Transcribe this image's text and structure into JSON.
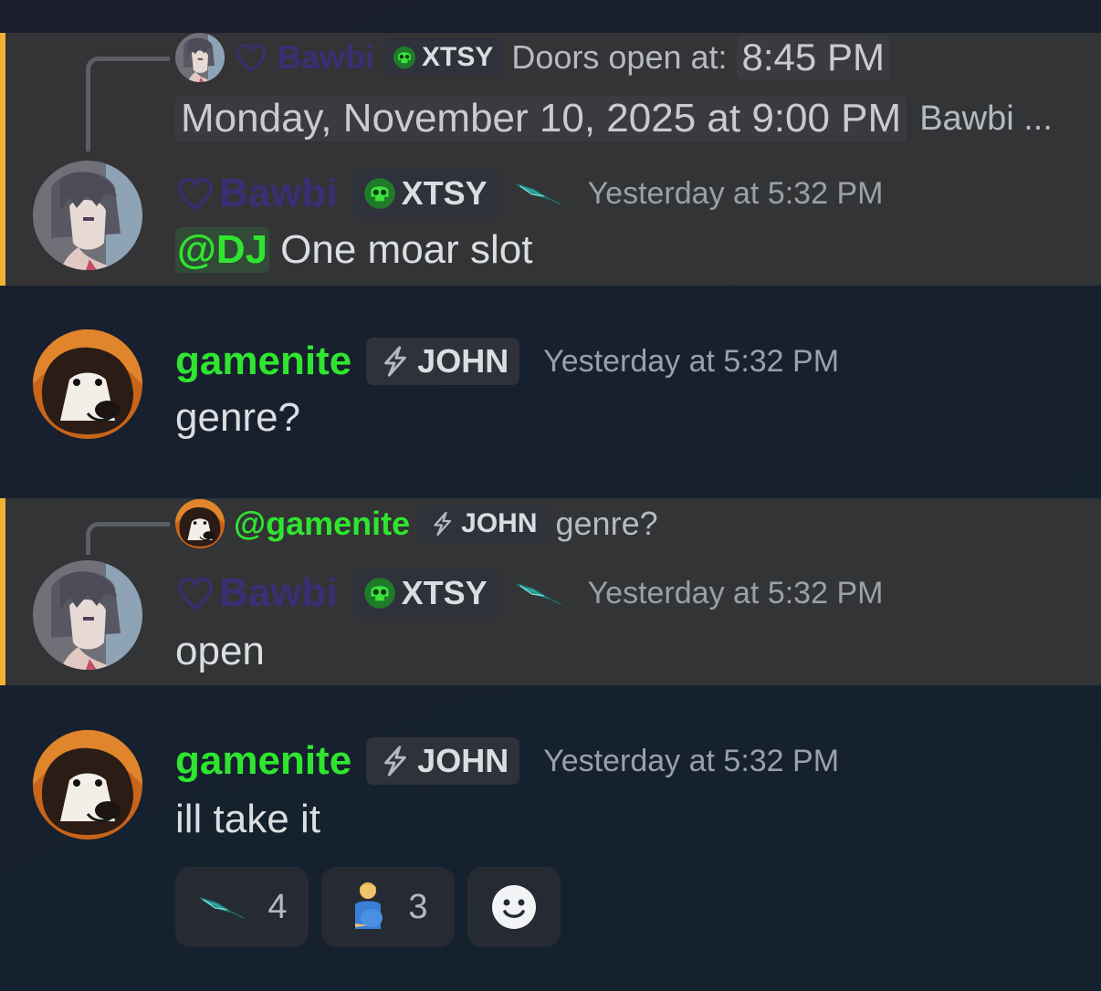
{
  "messages": [
    {
      "reply": {
        "author": "Bawbi",
        "role_tag": "XTSY",
        "text": "Doors open at:",
        "timestamp_chip": "8:45 PM",
        "timestamp_full": "Monday, November 10, 2025 at 9:00 PM",
        "trailing": "Bawbi ..."
      },
      "author": "Bawbi",
      "role_tag": "XTSY",
      "timestamp": "Yesterday at 5:32 PM",
      "mention": "@DJ",
      "content": "One moar slot"
    },
    {
      "author": "gamenite",
      "role_tag": "JOHN",
      "timestamp": "Yesterday at 5:32 PM",
      "content": "genre?"
    },
    {
      "reply": {
        "author": "@gamenite",
        "role_tag": "JOHN",
        "text": "genre?"
      },
      "author": "Bawbi",
      "role_tag": "XTSY",
      "timestamp": "Yesterday at 5:32 PM",
      "content": "open"
    },
    {
      "author": "gamenite",
      "role_tag": "JOHN",
      "timestamp": "Yesterday at 5:32 PM",
      "content": "ill take it"
    }
  ],
  "reactions": [
    {
      "emoji": "custom-glyph-icon",
      "count": "4"
    },
    {
      "emoji": "pregnant-man-emoji",
      "count": "3"
    },
    {
      "emoji": "add-reaction-icon"
    }
  ],
  "colors": {
    "accent_highlight": "#f0b232",
    "gamenite_name": "#2fe52f",
    "bawbi_name": "#3a2e74"
  }
}
